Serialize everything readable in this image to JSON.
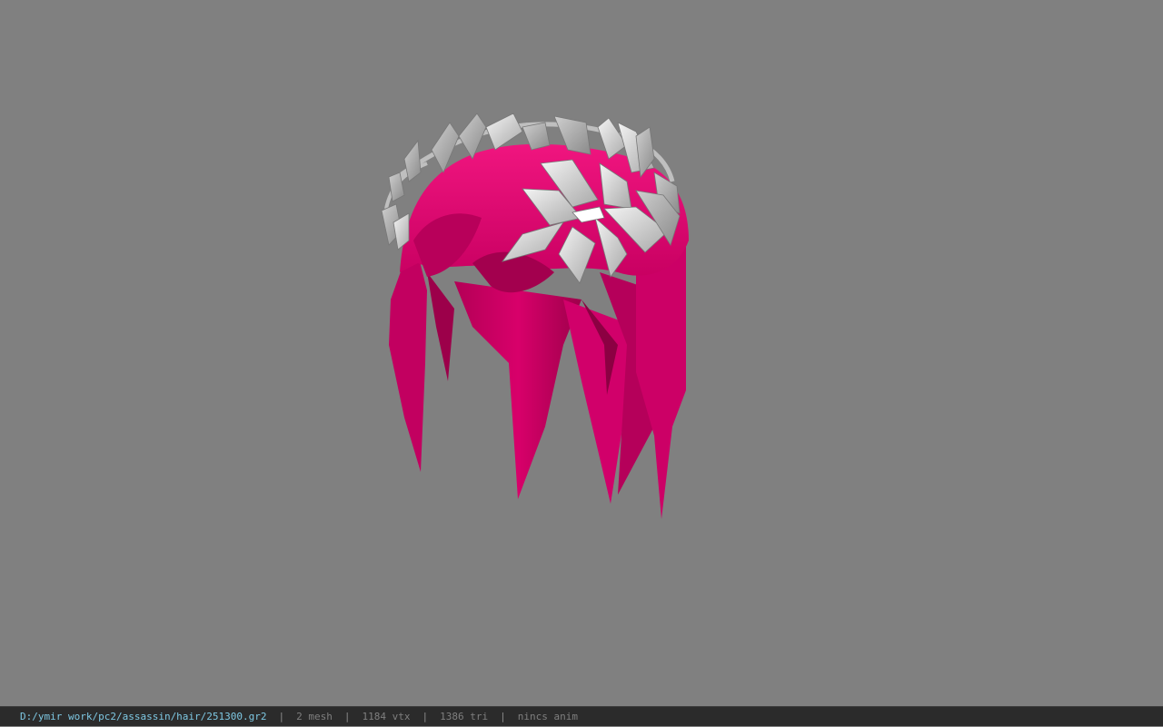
{
  "viewport": {
    "background_color": "#808080",
    "model": {
      "hair_color": "#E8006E",
      "wreath_color": "#D8D8D8"
    }
  },
  "statusbar": {
    "path": "D:/ymir work/pc2/assassin/hair/251300.gr2",
    "separator": "|",
    "mesh": "2 mesh",
    "vertices": "1184 vtx",
    "triangles": "1386 tri",
    "anim": "nincs anim"
  }
}
